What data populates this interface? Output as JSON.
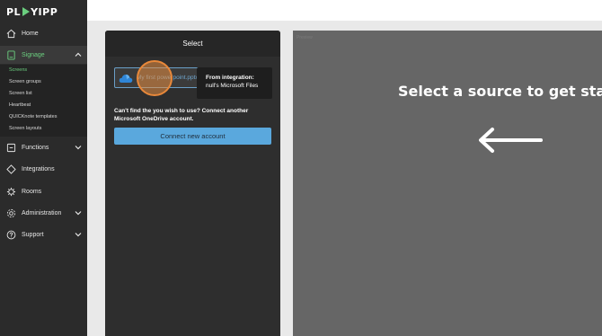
{
  "brand": {
    "logo_left": "PL",
    "logo_right": "YIPP"
  },
  "sidebar": {
    "items": [
      {
        "label": "Home",
        "icon": "home-icon"
      },
      {
        "label": "Signage",
        "icon": "signage-icon",
        "active": true
      },
      {
        "label": "Functions",
        "icon": "functions-icon"
      },
      {
        "label": "Integrations",
        "icon": "integrations-icon"
      },
      {
        "label": "Rooms",
        "icon": "rooms-icon"
      },
      {
        "label": "Administration",
        "icon": "gear-icon"
      },
      {
        "label": "Support",
        "icon": "help-icon"
      }
    ],
    "signage_sub": [
      {
        "label": "Screens",
        "active": true
      },
      {
        "label": "Screen groups"
      },
      {
        "label": "Screen list"
      },
      {
        "label": "Heartbeat"
      },
      {
        "label": "QUICKnote templates"
      },
      {
        "label": "Screen layouts"
      }
    ]
  },
  "select_panel": {
    "title": "Select",
    "file_name": "My first powerpoint.pptx",
    "tooltip": {
      "line1": "From integration:",
      "line2": "null's Microsoft Files"
    },
    "cant_find": "Can't find the you wish to use? Connect another Microsoft OneDrive account.",
    "connect_button": "Connect new account"
  },
  "preview": {
    "faint_label": "Preview",
    "title": "Select a source to get start"
  },
  "colors": {
    "accent_green": "#6bcf7f",
    "button_blue": "#5aa8dd",
    "highlight_orange": "#e8883a"
  }
}
